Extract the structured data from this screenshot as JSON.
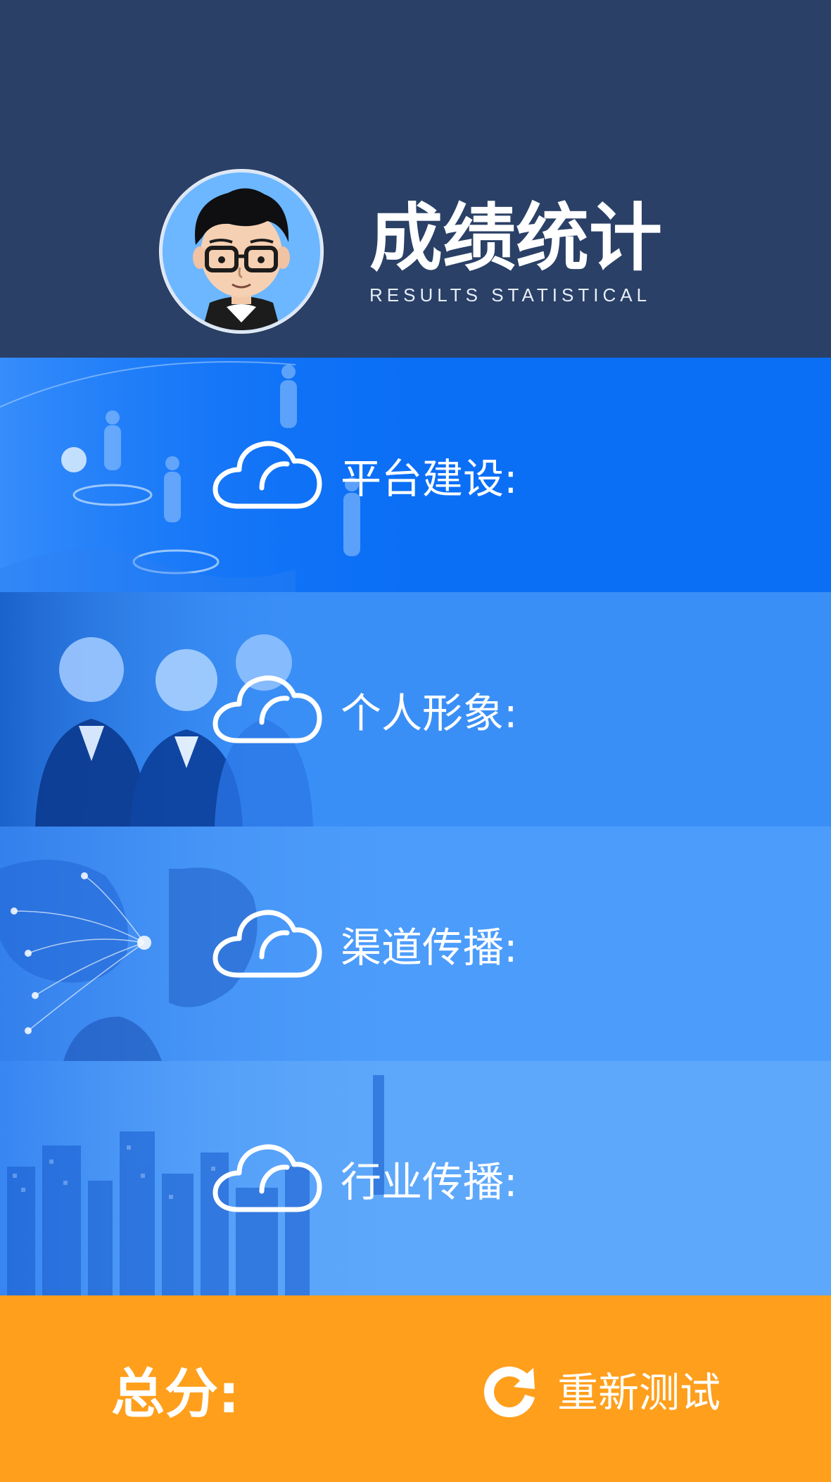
{
  "header": {
    "title": "成绩统计",
    "subtitle": "RESULTS  STATISTICAL"
  },
  "rows": [
    {
      "label": "平台建设:",
      "icon": "cloud-icon"
    },
    {
      "label": "个人形象:",
      "icon": "cloud-icon"
    },
    {
      "label": "渠道传播:",
      "icon": "cloud-icon"
    },
    {
      "label": "行业传播:",
      "icon": "cloud-icon"
    }
  ],
  "footer": {
    "total_label": "总分:",
    "retest_label": "重新测试",
    "retest_icon": "refresh-icon"
  },
  "colors": {
    "header_bg": "#2a4066",
    "row1_bg": "#0b6ff6",
    "row2_bg": "#3a8ff7",
    "row3_bg": "#4c9cfb",
    "row4_bg": "#5ea8fb",
    "footer_bg": "#ff9f1c",
    "text": "#ffffff"
  }
}
